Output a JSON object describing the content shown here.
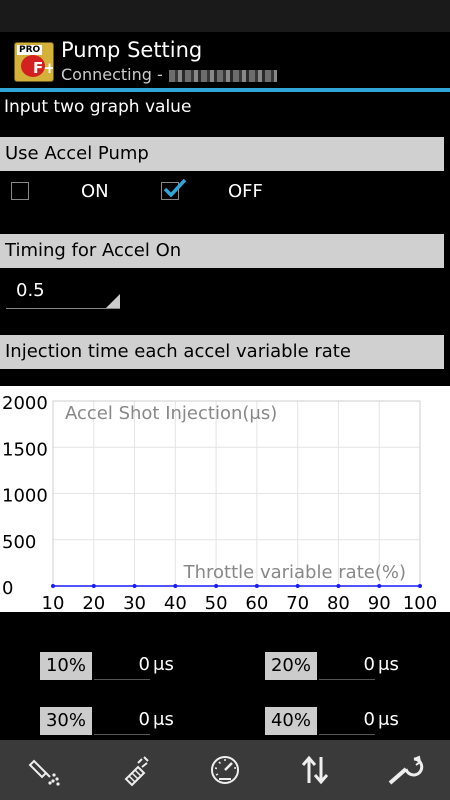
{
  "app": {
    "title": "Pump Setting",
    "subtitle": "Connecting -",
    "icon_text": "PRO",
    "icon_mark": "F+"
  },
  "instruction": "Input two graph value",
  "accel_pump": {
    "label": "Use Accel Pump",
    "on_label": "ON",
    "off_label": "OFF",
    "on_checked": false,
    "off_checked": true
  },
  "timing": {
    "label": "Timing for Accel On",
    "value": "0.5"
  },
  "injection": {
    "label": "Injection time each accel variable rate"
  },
  "chart_data": {
    "type": "line",
    "title": "Accel Shot Injection(μs)",
    "xlabel": "Throttle variable rate(%)",
    "ylabel": "",
    "x": [
      10,
      20,
      30,
      40,
      50,
      60,
      70,
      80,
      90,
      100
    ],
    "series": [
      {
        "values": [
          0,
          0,
          0,
          0,
          0,
          0,
          0,
          0,
          0,
          0
        ]
      }
    ],
    "xlim": [
      10,
      100
    ],
    "ylim": [
      0,
      2000
    ],
    "yticks": [
      "2000",
      "1500",
      "1000",
      "500",
      "0"
    ],
    "xticks": [
      "10",
      "20",
      "30",
      "40",
      "50",
      "60",
      "70",
      "80",
      "90",
      "100"
    ],
    "grid": true,
    "line_color": "#1a1aff"
  },
  "rates": [
    {
      "label": "10%",
      "value": "0",
      "unit": "μs"
    },
    {
      "label": "20%",
      "value": "0",
      "unit": "μs"
    },
    {
      "label": "30%",
      "value": "0",
      "unit": "μs"
    },
    {
      "label": "40%",
      "value": "0",
      "unit": "μs"
    }
  ],
  "nav": [
    {
      "icon": "spray-icon"
    },
    {
      "icon": "engine-icon"
    },
    {
      "icon": "speedometer-icon"
    },
    {
      "icon": "transfer-arrows-icon"
    },
    {
      "icon": "wrench-icon"
    }
  ],
  "colors": {
    "accent": "#31a5d8",
    "section_bar": "#d0d0d0"
  }
}
